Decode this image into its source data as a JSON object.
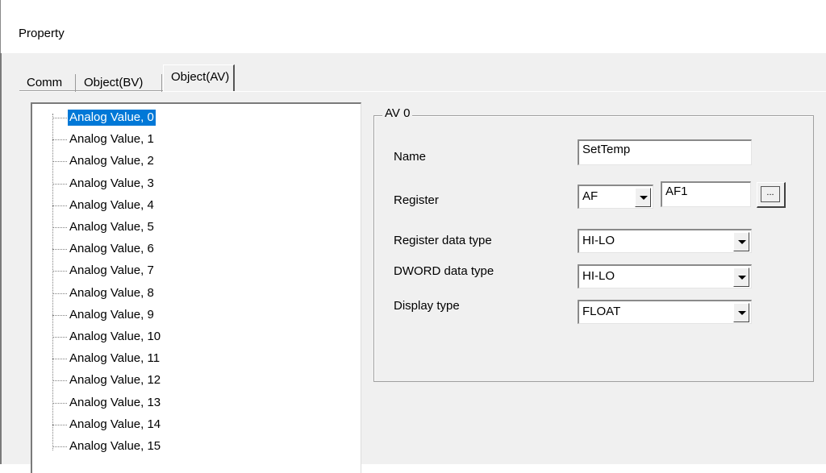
{
  "window": {
    "title": "Property"
  },
  "tabs": [
    {
      "label": "Comm",
      "active": false
    },
    {
      "label": "Object(BV)",
      "active": false
    },
    {
      "label": "Object(AV)",
      "active": true
    }
  ],
  "tree": {
    "items": [
      {
        "label": "Analog Value, 0",
        "selected": true
      },
      {
        "label": "Analog Value, 1"
      },
      {
        "label": "Analog Value, 2"
      },
      {
        "label": "Analog Value, 3"
      },
      {
        "label": "Analog Value, 4"
      },
      {
        "label": "Analog Value, 5"
      },
      {
        "label": "Analog Value, 6"
      },
      {
        "label": "Analog Value, 7"
      },
      {
        "label": "Analog Value, 8"
      },
      {
        "label": "Analog Value, 9"
      },
      {
        "label": "Analog Value, 10"
      },
      {
        "label": "Analog Value, 11"
      },
      {
        "label": "Analog Value, 12"
      },
      {
        "label": "Analog Value, 13"
      },
      {
        "label": "Analog Value, 14"
      },
      {
        "label": "Analog Value, 15"
      }
    ]
  },
  "panel": {
    "group_title": "AV 0",
    "name_label": "Name",
    "name_value": "SetTemp",
    "register_label": "Register",
    "register_type_value": "AF",
    "register_value": "AF1",
    "browse_label": "...",
    "register_data_type_label": "Register data type",
    "register_data_type_value": "HI-LO",
    "dword_data_type_label": "DWORD data type",
    "dword_data_type_value": "HI-LO",
    "display_type_label": "Display type",
    "display_type_value": "FLOAT"
  },
  "colors": {
    "selection": "#0078d7",
    "dialog_bg": "#f0f0f0"
  }
}
